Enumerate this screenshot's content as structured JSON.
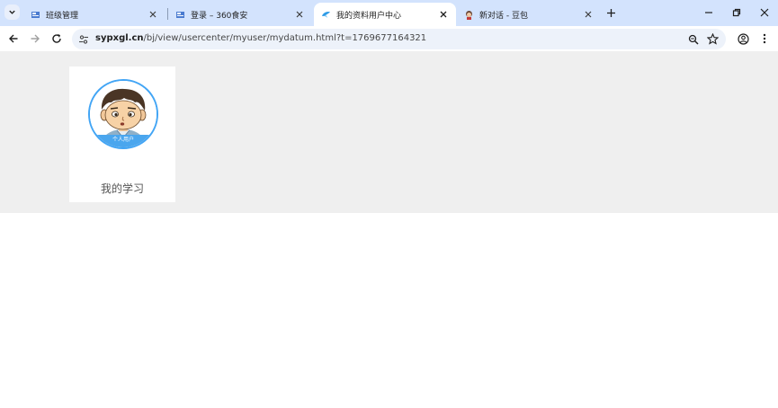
{
  "browser": {
    "tabs": [
      {
        "title": "班级管理",
        "active": false,
        "favicon": "doc-favicon"
      },
      {
        "title": "登录 – 360食安",
        "active": false,
        "favicon": "doc-favicon"
      },
      {
        "title": "我的资料用户中心",
        "active": true,
        "favicon": "bird-favicon"
      },
      {
        "title": "新对话 - 豆包",
        "active": false,
        "favicon": "doubao-favicon"
      }
    ],
    "url_host": "sypxgl.cn",
    "url_path": "/bj/view/usercenter/myuser/mydatum.html?t=1769677164321"
  },
  "page": {
    "card_label": "我的学习",
    "avatar_caption": "个人用户"
  },
  "colors": {
    "tabstrip": "#d3e3fd",
    "content_bg": "#efefef",
    "avatar_ring": "#42a5f5"
  }
}
